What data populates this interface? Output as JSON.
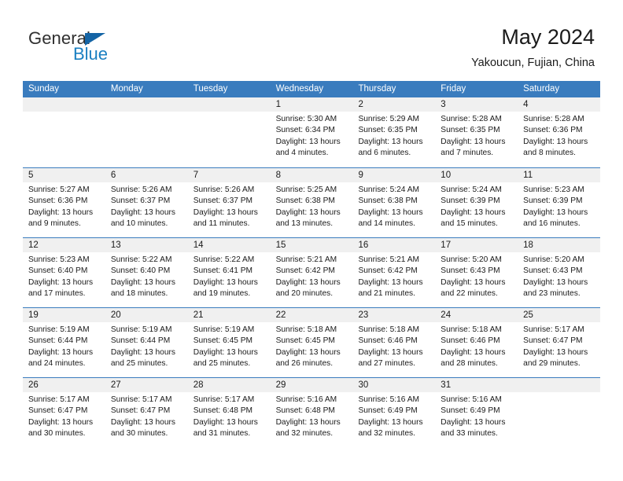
{
  "brand": {
    "name_part1": "General",
    "name_part2": "Blue",
    "color_primary": "#1a7fc1",
    "color_text": "#303030"
  },
  "header": {
    "title": "May 2024",
    "subtitle": "Yakoucun, Fujian, China"
  },
  "theme": {
    "header_bg": "#3a7cbe",
    "header_text": "#ffffff",
    "day_strip_bg": "#f0f0f0",
    "cell_bg": "#ffffff",
    "row_border": "#3a7cbe"
  },
  "weekdays": [
    "Sunday",
    "Monday",
    "Tuesday",
    "Wednesday",
    "Thursday",
    "Friday",
    "Saturday"
  ],
  "weeks": [
    [
      {
        "day": "",
        "empty": true
      },
      {
        "day": "",
        "empty": true
      },
      {
        "day": "",
        "empty": true
      },
      {
        "day": "1",
        "sunrise": "Sunrise: 5:30 AM",
        "sunset": "Sunset: 6:34 PM",
        "daylight_line1": "Daylight: 13 hours",
        "daylight_line2": "and 4 minutes."
      },
      {
        "day": "2",
        "sunrise": "Sunrise: 5:29 AM",
        "sunset": "Sunset: 6:35 PM",
        "daylight_line1": "Daylight: 13 hours",
        "daylight_line2": "and 6 minutes."
      },
      {
        "day": "3",
        "sunrise": "Sunrise: 5:28 AM",
        "sunset": "Sunset: 6:35 PM",
        "daylight_line1": "Daylight: 13 hours",
        "daylight_line2": "and 7 minutes."
      },
      {
        "day": "4",
        "sunrise": "Sunrise: 5:28 AM",
        "sunset": "Sunset: 6:36 PM",
        "daylight_line1": "Daylight: 13 hours",
        "daylight_line2": "and 8 minutes."
      }
    ],
    [
      {
        "day": "5",
        "sunrise": "Sunrise: 5:27 AM",
        "sunset": "Sunset: 6:36 PM",
        "daylight_line1": "Daylight: 13 hours",
        "daylight_line2": "and 9 minutes."
      },
      {
        "day": "6",
        "sunrise": "Sunrise: 5:26 AM",
        "sunset": "Sunset: 6:37 PM",
        "daylight_line1": "Daylight: 13 hours",
        "daylight_line2": "and 10 minutes."
      },
      {
        "day": "7",
        "sunrise": "Sunrise: 5:26 AM",
        "sunset": "Sunset: 6:37 PM",
        "daylight_line1": "Daylight: 13 hours",
        "daylight_line2": "and 11 minutes."
      },
      {
        "day": "8",
        "sunrise": "Sunrise: 5:25 AM",
        "sunset": "Sunset: 6:38 PM",
        "daylight_line1": "Daylight: 13 hours",
        "daylight_line2": "and 13 minutes."
      },
      {
        "day": "9",
        "sunrise": "Sunrise: 5:24 AM",
        "sunset": "Sunset: 6:38 PM",
        "daylight_line1": "Daylight: 13 hours",
        "daylight_line2": "and 14 minutes."
      },
      {
        "day": "10",
        "sunrise": "Sunrise: 5:24 AM",
        "sunset": "Sunset: 6:39 PM",
        "daylight_line1": "Daylight: 13 hours",
        "daylight_line2": "and 15 minutes."
      },
      {
        "day": "11",
        "sunrise": "Sunrise: 5:23 AM",
        "sunset": "Sunset: 6:39 PM",
        "daylight_line1": "Daylight: 13 hours",
        "daylight_line2": "and 16 minutes."
      }
    ],
    [
      {
        "day": "12",
        "sunrise": "Sunrise: 5:23 AM",
        "sunset": "Sunset: 6:40 PM",
        "daylight_line1": "Daylight: 13 hours",
        "daylight_line2": "and 17 minutes."
      },
      {
        "day": "13",
        "sunrise": "Sunrise: 5:22 AM",
        "sunset": "Sunset: 6:40 PM",
        "daylight_line1": "Daylight: 13 hours",
        "daylight_line2": "and 18 minutes."
      },
      {
        "day": "14",
        "sunrise": "Sunrise: 5:22 AM",
        "sunset": "Sunset: 6:41 PM",
        "daylight_line1": "Daylight: 13 hours",
        "daylight_line2": "and 19 minutes."
      },
      {
        "day": "15",
        "sunrise": "Sunrise: 5:21 AM",
        "sunset": "Sunset: 6:42 PM",
        "daylight_line1": "Daylight: 13 hours",
        "daylight_line2": "and 20 minutes."
      },
      {
        "day": "16",
        "sunrise": "Sunrise: 5:21 AM",
        "sunset": "Sunset: 6:42 PM",
        "daylight_line1": "Daylight: 13 hours",
        "daylight_line2": "and 21 minutes."
      },
      {
        "day": "17",
        "sunrise": "Sunrise: 5:20 AM",
        "sunset": "Sunset: 6:43 PM",
        "daylight_line1": "Daylight: 13 hours",
        "daylight_line2": "and 22 minutes."
      },
      {
        "day": "18",
        "sunrise": "Sunrise: 5:20 AM",
        "sunset": "Sunset: 6:43 PM",
        "daylight_line1": "Daylight: 13 hours",
        "daylight_line2": "and 23 minutes."
      }
    ],
    [
      {
        "day": "19",
        "sunrise": "Sunrise: 5:19 AM",
        "sunset": "Sunset: 6:44 PM",
        "daylight_line1": "Daylight: 13 hours",
        "daylight_line2": "and 24 minutes."
      },
      {
        "day": "20",
        "sunrise": "Sunrise: 5:19 AM",
        "sunset": "Sunset: 6:44 PM",
        "daylight_line1": "Daylight: 13 hours",
        "daylight_line2": "and 25 minutes."
      },
      {
        "day": "21",
        "sunrise": "Sunrise: 5:19 AM",
        "sunset": "Sunset: 6:45 PM",
        "daylight_line1": "Daylight: 13 hours",
        "daylight_line2": "and 25 minutes."
      },
      {
        "day": "22",
        "sunrise": "Sunrise: 5:18 AM",
        "sunset": "Sunset: 6:45 PM",
        "daylight_line1": "Daylight: 13 hours",
        "daylight_line2": "and 26 minutes."
      },
      {
        "day": "23",
        "sunrise": "Sunrise: 5:18 AM",
        "sunset": "Sunset: 6:46 PM",
        "daylight_line1": "Daylight: 13 hours",
        "daylight_line2": "and 27 minutes."
      },
      {
        "day": "24",
        "sunrise": "Sunrise: 5:18 AM",
        "sunset": "Sunset: 6:46 PM",
        "daylight_line1": "Daylight: 13 hours",
        "daylight_line2": "and 28 minutes."
      },
      {
        "day": "25",
        "sunrise": "Sunrise: 5:17 AM",
        "sunset": "Sunset: 6:47 PM",
        "daylight_line1": "Daylight: 13 hours",
        "daylight_line2": "and 29 minutes."
      }
    ],
    [
      {
        "day": "26",
        "sunrise": "Sunrise: 5:17 AM",
        "sunset": "Sunset: 6:47 PM",
        "daylight_line1": "Daylight: 13 hours",
        "daylight_line2": "and 30 minutes."
      },
      {
        "day": "27",
        "sunrise": "Sunrise: 5:17 AM",
        "sunset": "Sunset: 6:47 PM",
        "daylight_line1": "Daylight: 13 hours",
        "daylight_line2": "and 30 minutes."
      },
      {
        "day": "28",
        "sunrise": "Sunrise: 5:17 AM",
        "sunset": "Sunset: 6:48 PM",
        "daylight_line1": "Daylight: 13 hours",
        "daylight_line2": "and 31 minutes."
      },
      {
        "day": "29",
        "sunrise": "Sunrise: 5:16 AM",
        "sunset": "Sunset: 6:48 PM",
        "daylight_line1": "Daylight: 13 hours",
        "daylight_line2": "and 32 minutes."
      },
      {
        "day": "30",
        "sunrise": "Sunrise: 5:16 AM",
        "sunset": "Sunset: 6:49 PM",
        "daylight_line1": "Daylight: 13 hours",
        "daylight_line2": "and 32 minutes."
      },
      {
        "day": "31",
        "sunrise": "Sunrise: 5:16 AM",
        "sunset": "Sunset: 6:49 PM",
        "daylight_line1": "Daylight: 13 hours",
        "daylight_line2": "and 33 minutes."
      },
      {
        "day": "",
        "empty": true
      }
    ]
  ]
}
